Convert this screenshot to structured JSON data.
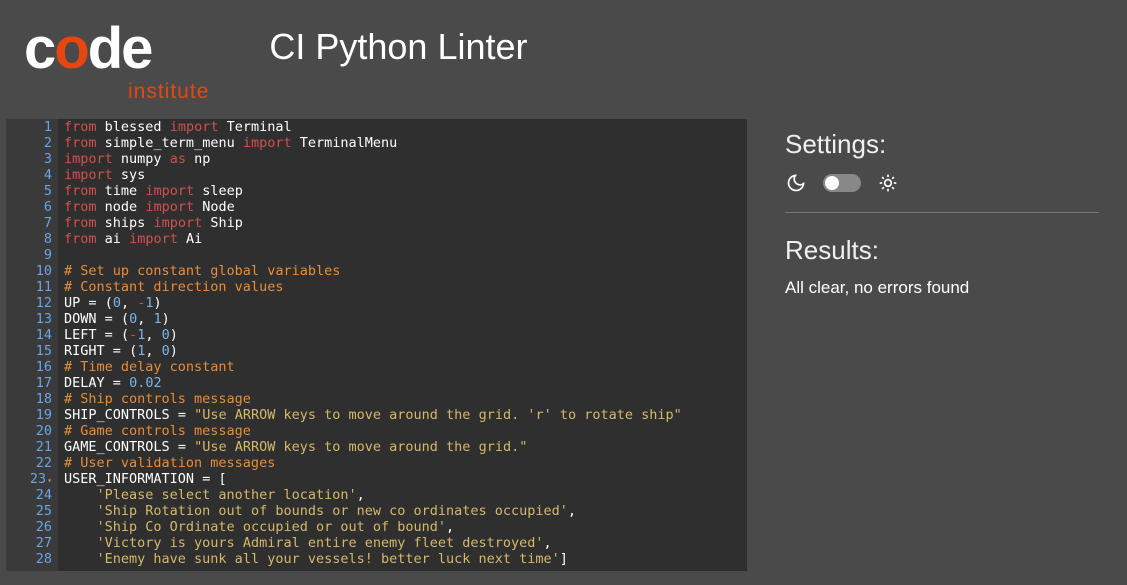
{
  "logo": {
    "main_white1": "c",
    "main_orange": "o",
    "main_white2": "de",
    "sub": "institute"
  },
  "page_title": "CI Python Linter",
  "code": {
    "lines": [
      {
        "n": "1",
        "tokens": [
          [
            "kw",
            "from"
          ],
          [
            "sp",
            " "
          ],
          [
            "mod",
            "blessed"
          ],
          [
            "sp",
            " "
          ],
          [
            "kw",
            "import"
          ],
          [
            "sp",
            " "
          ],
          [
            "mod",
            "Terminal"
          ]
        ]
      },
      {
        "n": "2",
        "tokens": [
          [
            "kw",
            "from"
          ],
          [
            "sp",
            " "
          ],
          [
            "mod",
            "simple_term_menu"
          ],
          [
            "sp",
            " "
          ],
          [
            "kw",
            "import"
          ],
          [
            "sp",
            " "
          ],
          [
            "mod",
            "TerminalMenu"
          ]
        ]
      },
      {
        "n": "3",
        "tokens": [
          [
            "kw",
            "import"
          ],
          [
            "sp",
            " "
          ],
          [
            "mod",
            "numpy"
          ],
          [
            "sp",
            " "
          ],
          [
            "kw",
            "as"
          ],
          [
            "sp",
            " "
          ],
          [
            "mod",
            "np"
          ]
        ]
      },
      {
        "n": "4",
        "tokens": [
          [
            "kw",
            "import"
          ],
          [
            "sp",
            " "
          ],
          [
            "mod",
            "sys"
          ]
        ]
      },
      {
        "n": "5",
        "tokens": [
          [
            "kw",
            "from"
          ],
          [
            "sp",
            " "
          ],
          [
            "mod",
            "time"
          ],
          [
            "sp",
            " "
          ],
          [
            "kw",
            "import"
          ],
          [
            "sp",
            " "
          ],
          [
            "mod",
            "sleep"
          ]
        ]
      },
      {
        "n": "6",
        "tokens": [
          [
            "kw",
            "from"
          ],
          [
            "sp",
            " "
          ],
          [
            "mod",
            "node"
          ],
          [
            "sp",
            " "
          ],
          [
            "kw",
            "import"
          ],
          [
            "sp",
            " "
          ],
          [
            "mod",
            "Node"
          ]
        ]
      },
      {
        "n": "7",
        "tokens": [
          [
            "kw",
            "from"
          ],
          [
            "sp",
            " "
          ],
          [
            "mod",
            "ships"
          ],
          [
            "sp",
            " "
          ],
          [
            "kw",
            "import"
          ],
          [
            "sp",
            " "
          ],
          [
            "mod",
            "Ship"
          ]
        ]
      },
      {
        "n": "8",
        "tokens": [
          [
            "kw",
            "from"
          ],
          [
            "sp",
            " "
          ],
          [
            "mod",
            "ai"
          ],
          [
            "sp",
            " "
          ],
          [
            "kw",
            "import"
          ],
          [
            "sp",
            " "
          ],
          [
            "mod",
            "Ai"
          ]
        ]
      },
      {
        "n": "9",
        "tokens": []
      },
      {
        "n": "10",
        "tokens": [
          [
            "comment",
            "# Set up constant global variables"
          ]
        ]
      },
      {
        "n": "11",
        "tokens": [
          [
            "comment",
            "# Constant direction values"
          ]
        ]
      },
      {
        "n": "12",
        "tokens": [
          [
            "name",
            "UP"
          ],
          [
            "sp",
            " "
          ],
          [
            "op",
            "="
          ],
          [
            "sp",
            " "
          ],
          [
            "paren",
            "("
          ],
          [
            "num",
            "0"
          ],
          [
            "op",
            ","
          ],
          [
            "sp",
            " "
          ],
          [
            "neg",
            "-"
          ],
          [
            "num",
            "1"
          ],
          [
            "paren",
            ")"
          ]
        ]
      },
      {
        "n": "13",
        "tokens": [
          [
            "name",
            "DOWN"
          ],
          [
            "sp",
            " "
          ],
          [
            "op",
            "="
          ],
          [
            "sp",
            " "
          ],
          [
            "paren",
            "("
          ],
          [
            "num",
            "0"
          ],
          [
            "op",
            ","
          ],
          [
            "sp",
            " "
          ],
          [
            "num",
            "1"
          ],
          [
            "paren",
            ")"
          ]
        ]
      },
      {
        "n": "14",
        "tokens": [
          [
            "name",
            "LEFT"
          ],
          [
            "sp",
            " "
          ],
          [
            "op",
            "="
          ],
          [
            "sp",
            " "
          ],
          [
            "paren",
            "("
          ],
          [
            "neg",
            "-"
          ],
          [
            "num",
            "1"
          ],
          [
            "op",
            ","
          ],
          [
            "sp",
            " "
          ],
          [
            "num",
            "0"
          ],
          [
            "paren",
            ")"
          ]
        ]
      },
      {
        "n": "15",
        "tokens": [
          [
            "name",
            "RIGHT"
          ],
          [
            "sp",
            " "
          ],
          [
            "op",
            "="
          ],
          [
            "sp",
            " "
          ],
          [
            "paren",
            "("
          ],
          [
            "num",
            "1"
          ],
          [
            "op",
            ","
          ],
          [
            "sp",
            " "
          ],
          [
            "num",
            "0"
          ],
          [
            "paren",
            ")"
          ]
        ]
      },
      {
        "n": "16",
        "tokens": [
          [
            "comment",
            "# Time delay constant"
          ]
        ]
      },
      {
        "n": "17",
        "tokens": [
          [
            "name",
            "DELAY"
          ],
          [
            "sp",
            " "
          ],
          [
            "op",
            "="
          ],
          [
            "sp",
            " "
          ],
          [
            "num",
            "0.02"
          ]
        ]
      },
      {
        "n": "18",
        "tokens": [
          [
            "comment",
            "# Ship controls message"
          ]
        ]
      },
      {
        "n": "19",
        "tokens": [
          [
            "name",
            "SHIP_CONTROLS"
          ],
          [
            "sp",
            " "
          ],
          [
            "op",
            "="
          ],
          [
            "sp",
            " "
          ],
          [
            "str",
            "\"Use ARROW keys to move around the grid. 'r' to rotate ship\""
          ]
        ]
      },
      {
        "n": "20",
        "tokens": [
          [
            "comment",
            "# Game controls message"
          ]
        ]
      },
      {
        "n": "21",
        "tokens": [
          [
            "name",
            "GAME_CONTROLS"
          ],
          [
            "sp",
            " "
          ],
          [
            "op",
            "="
          ],
          [
            "sp",
            " "
          ],
          [
            "str",
            "\"Use ARROW keys to move around the grid.\""
          ]
        ]
      },
      {
        "n": "22",
        "tokens": [
          [
            "comment",
            "# User validation messages"
          ]
        ]
      },
      {
        "n": "23",
        "fold": true,
        "tokens": [
          [
            "name",
            "USER_INFORMATION"
          ],
          [
            "sp",
            " "
          ],
          [
            "op",
            "="
          ],
          [
            "sp",
            " "
          ],
          [
            "bracket",
            "["
          ]
        ]
      },
      {
        "n": "24",
        "tokens": [
          [
            "sp",
            "    "
          ],
          [
            "str",
            "'Please select another location'"
          ],
          [
            "op",
            ","
          ]
        ]
      },
      {
        "n": "25",
        "tokens": [
          [
            "sp",
            "    "
          ],
          [
            "str",
            "'Ship Rotation out of bounds or new co ordinates occupied'"
          ],
          [
            "op",
            ","
          ]
        ]
      },
      {
        "n": "26",
        "tokens": [
          [
            "sp",
            "    "
          ],
          [
            "str",
            "'Ship Co Ordinate occupied or out of bound'"
          ],
          [
            "op",
            ","
          ]
        ]
      },
      {
        "n": "27",
        "tokens": [
          [
            "sp",
            "    "
          ],
          [
            "str",
            "'Victory is yours Admiral entire enemy fleet destroyed'"
          ],
          [
            "op",
            ","
          ]
        ]
      },
      {
        "n": "28",
        "tokens": [
          [
            "sp",
            "    "
          ],
          [
            "str",
            "'Enemy have sunk all your vessels! better luck next time'"
          ],
          [
            "bracket",
            "]"
          ]
        ]
      }
    ]
  },
  "sidebar": {
    "settings_title": "Settings:",
    "results_title": "Results:",
    "results_text": "All clear, no errors found"
  }
}
